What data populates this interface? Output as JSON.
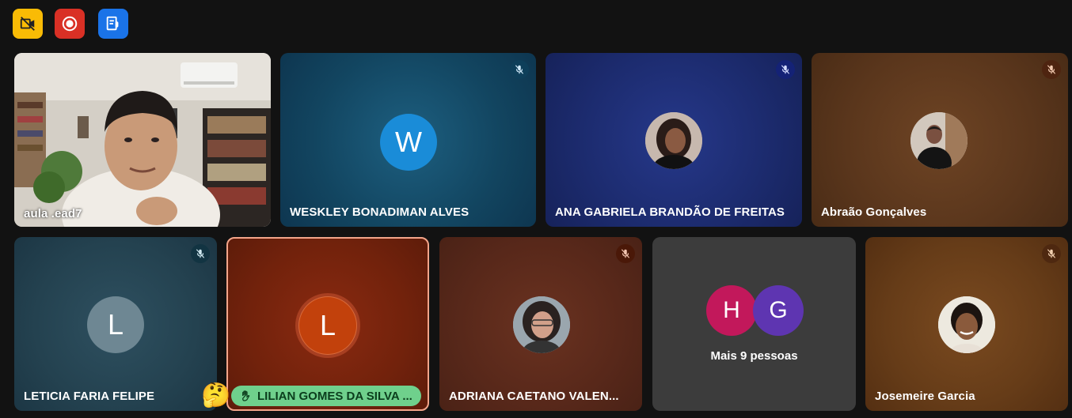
{
  "toolbar": {
    "buttons": [
      {
        "icon": "video-off-icon",
        "color": "#f9bb05"
      },
      {
        "icon": "record-icon",
        "color": "#d93025"
      },
      {
        "icon": "notes-icon",
        "color": "#1a73e8"
      }
    ]
  },
  "participants": [
    {
      "name": "aula .ead7",
      "type": "video"
    },
    {
      "name": "WESKLEY BONADIMAN ALVES",
      "initial": "W",
      "muted": true
    },
    {
      "name": "ANA GABRIELA BRANDÃO DE FREITAS",
      "muted": true
    },
    {
      "name": "Abraão Gonçalves",
      "muted": true
    },
    {
      "name": "LETICIA FARIA FELIPE",
      "initial": "L",
      "muted": true
    },
    {
      "name": "LILIAN GOMES DA SILVA ...",
      "initial": "L",
      "hand_raised": true,
      "reaction": "🤔"
    },
    {
      "name": "ADRIANA CAETANO VALEN...",
      "muted": true
    },
    {
      "name": "Josemeire Garcia",
      "muted": true
    }
  ],
  "overflow": {
    "initials": [
      "H",
      "G"
    ],
    "label": "Mais 9 pessoas"
  }
}
